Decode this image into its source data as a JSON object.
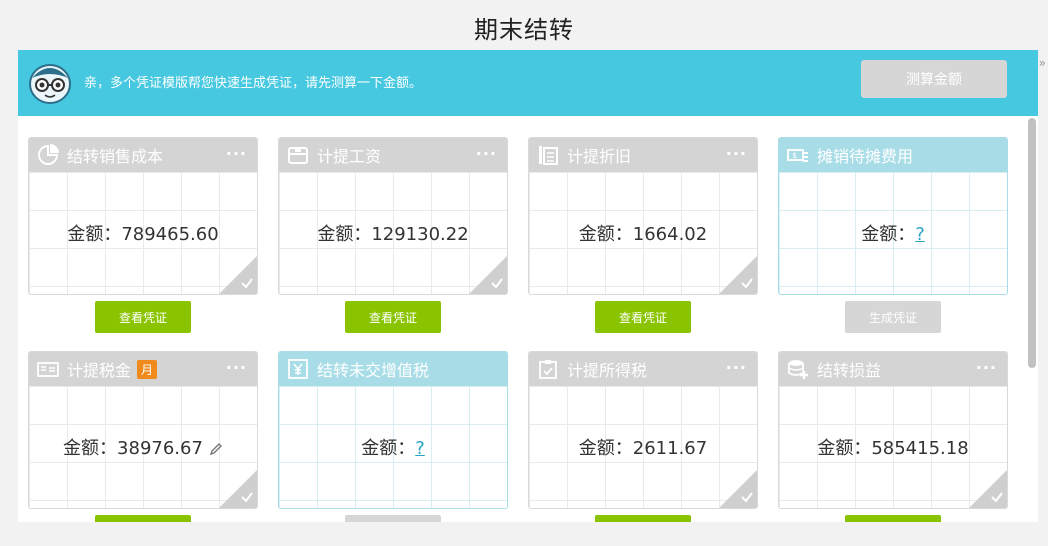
{
  "page": {
    "title": "期末结转"
  },
  "banner": {
    "message": "亲，多个凭证模版帮您快速生成凭证，请先测算一下金额。",
    "calc_button": "测算金额"
  },
  "collapse_toggle": "»",
  "menu_dots": "···",
  "cards": [
    {
      "title": "结转销售成本",
      "amount_label": "金额：",
      "amount": "789465.60",
      "button": "查看凭证"
    },
    {
      "title": "计提工资",
      "amount_label": "金额：",
      "amount": "129130.22",
      "button": "查看凭证"
    },
    {
      "title": "计提折旧",
      "amount_label": "金额：",
      "amount": "1664.02",
      "button": "查看凭证"
    },
    {
      "title": "摊销待摊费用",
      "amount_label": "金额：",
      "amount": "?",
      "button": "生成凭证"
    },
    {
      "title": "计提税金",
      "badge": "月",
      "amount_label": "金额：",
      "amount": "38976.67"
    },
    {
      "title": "结转未交增值税",
      "amount_label": "金额：",
      "amount": "?"
    },
    {
      "title": "计提所得税",
      "amount_label": "金额：",
      "amount": "2611.67"
    },
    {
      "title": "结转损益",
      "amount_label": "金额：",
      "amount": "585415.18"
    }
  ],
  "icons": {
    "mascot": "mascot-icon",
    "card0": "pie-chart-icon",
    "card1": "wallet-icon",
    "card2": "document-stack-icon",
    "card3": "money-icon",
    "card4": "tax-form-icon",
    "card5": "yen-icon",
    "card6": "clipboard-check-icon",
    "card7": "coins-plus-icon"
  },
  "colors": {
    "banner": "#45c8e0",
    "green_button": "#8ac400",
    "disabled_button": "#d6d6d6",
    "header_gray": "#d4d4d4",
    "header_blue": "#a8dde7",
    "badge_orange": "#f08a1c"
  }
}
